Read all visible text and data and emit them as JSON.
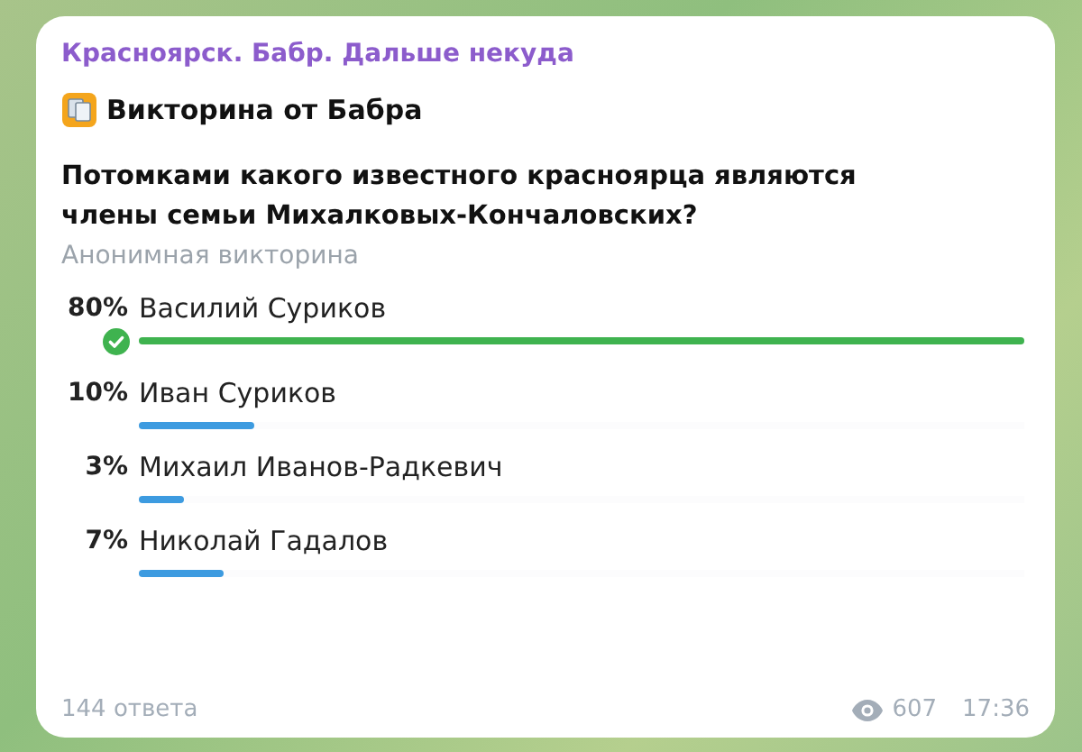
{
  "channel": {
    "name": "Красноярск. Бабр. Дальше некуда"
  },
  "quiz": {
    "title": "Викторина от Бабра",
    "question": "Потомками какого известного красноярца являются члены семьи Михалковых-Кончаловских?",
    "type_label": "Анонимная викторина",
    "options": [
      {
        "percent": "80%",
        "label": "Василий Суриков",
        "level": 1,
        "correct": true
      },
      {
        "percent": "10%",
        "label": "Иван Суриков",
        "level": 0.13,
        "correct": false
      },
      {
        "percent": "3%",
        "label": "Михаил Иванов-Радкевич",
        "level": 0.05,
        "correct": false
      },
      {
        "percent": "7%",
        "label": "Николай Гадалов",
        "level": 0.096,
        "correct": false
      }
    ],
    "answers": "144 ответа"
  },
  "footer": {
    "views": "607",
    "time": "17:36"
  }
}
